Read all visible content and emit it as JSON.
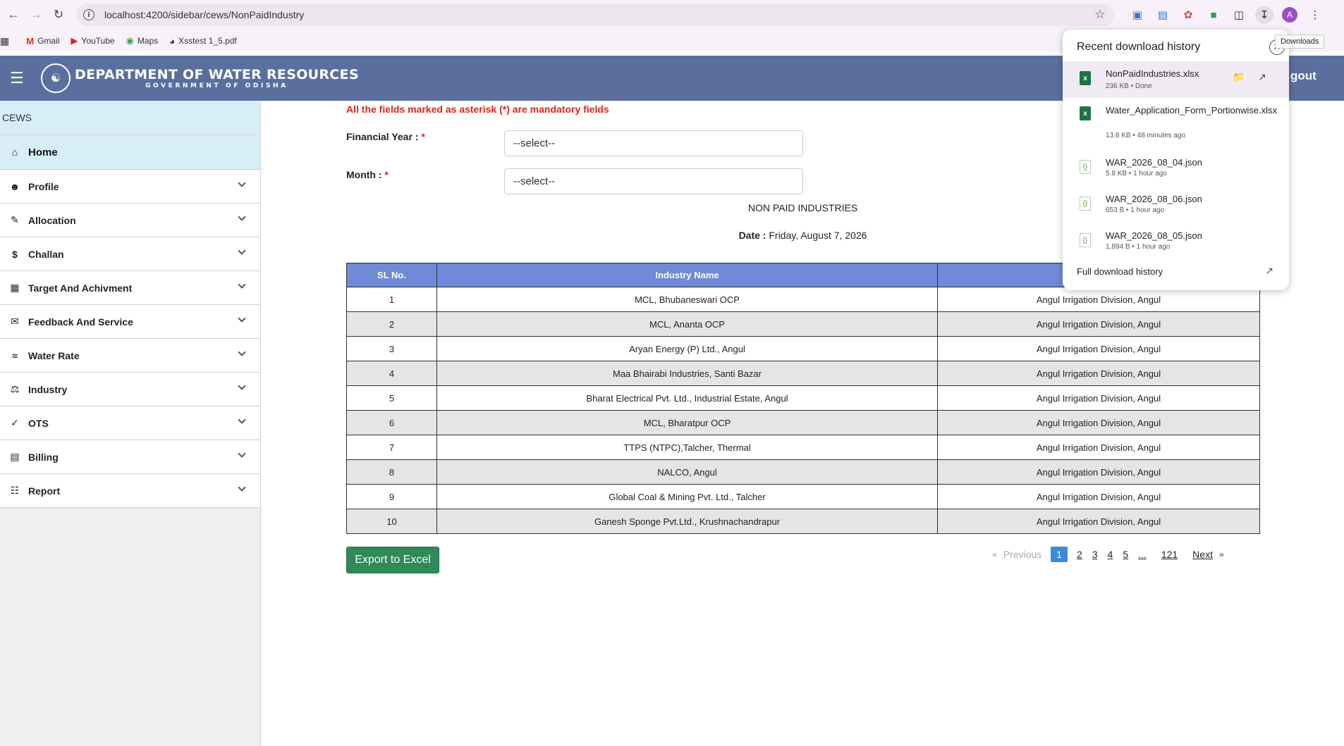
{
  "browser": {
    "url": "localhost:4200/sidebar/cews/NonPaidIndustry",
    "bookmarks": [
      {
        "label": "Gmail"
      },
      {
        "label": "YouTube"
      },
      {
        "label": "Maps"
      },
      {
        "label": "Xsstest 1_5.pdf"
      }
    ],
    "profile_initial": "A",
    "downloads_tooltip": "Downloads"
  },
  "header": {
    "title": "DEPARTMENT OF WATER RESOURCES",
    "subtitle": "GOVERNMENT OF ODISHA",
    "logout_label": "gout"
  },
  "sidebar": {
    "brand": "CEWS",
    "home_label": "Home",
    "items": [
      {
        "label": "Profile",
        "icon": "person-circle-icon"
      },
      {
        "label": "Allocation",
        "icon": "file-edit-icon"
      },
      {
        "label": "Challan",
        "icon": "dollar-circle-icon"
      },
      {
        "label": "Target And Achivment",
        "icon": "calendar-icon"
      },
      {
        "label": "Feedback And Service",
        "icon": "feedback-icon"
      },
      {
        "label": "Water Rate",
        "icon": "water-waves-icon"
      },
      {
        "label": "Industry",
        "icon": "factory-icon"
      },
      {
        "label": "OTS",
        "icon": "check-icon"
      },
      {
        "label": "Billing",
        "icon": "list-icon"
      },
      {
        "label": "Report",
        "icon": "books-icon"
      }
    ]
  },
  "form": {
    "mandatory_note": "All the fields marked as asterisk (*) are mandatory fields",
    "financial_year_label": "Financial Year :",
    "month_label": "Month :",
    "required_mark": "*",
    "financial_year_value": "--select--",
    "month_value": "--select--"
  },
  "report": {
    "title": "NON PAID INDUSTRIES",
    "date_label": "Date :",
    "date_value": "Friday, August 7, 2026"
  },
  "table": {
    "headers": [
      "SL No.",
      "Industry Name",
      ""
    ],
    "rows": [
      [
        "1",
        "MCL, Bhubaneswari OCP",
        "Angul Irrigation Division, Angul"
      ],
      [
        "2",
        "MCL, Ananta OCP",
        "Angul Irrigation Division, Angul"
      ],
      [
        "3",
        "Aryan Energy (P) Ltd., Angul",
        "Angul Irrigation Division, Angul"
      ],
      [
        "4",
        "Maa Bhairabi Industries, Santi Bazar",
        "Angul Irrigation Division, Angul"
      ],
      [
        "5",
        "Bharat Electrical Pvt. Ltd., Industrial Estate, Angul",
        "Angul Irrigation Division, Angul"
      ],
      [
        "6",
        "MCL, Bharatpur OCP",
        "Angul Irrigation Division, Angul"
      ],
      [
        "7",
        "TTPS (NTPC),Talcher, Thermal",
        "Angul Irrigation Division, Angul"
      ],
      [
        "8",
        "NALCO, Angul",
        "Angul Irrigation Division, Angul"
      ],
      [
        "9",
        "Global Coal & Mining Pvt. Ltd., Talcher",
        "Angul Irrigation Division, Angul"
      ],
      [
        "10",
        "Ganesh Sponge Pvt.Ltd., Krushnachandrapur",
        "Angul Irrigation Division, Angul"
      ]
    ]
  },
  "export_label": "Export to Excel",
  "pagination": {
    "prev_symbol": "«",
    "prev_label": "Previous",
    "pages": [
      "1",
      "2",
      "3",
      "4",
      "5",
      "...",
      "121"
    ],
    "active_page": "1",
    "next_label": "Next",
    "next_symbol": "»"
  },
  "downloads": {
    "title": "Recent download history",
    "items": [
      {
        "name": "NonPaidIndustries.xlsx",
        "meta": "236 KB • Done",
        "type": "xlsx"
      },
      {
        "name": "Water_Application_Form_Portionwise.xlsx",
        "meta": "13.8 KB • 48 minutes ago",
        "type": "xlsx"
      },
      {
        "name": "WAR_2026_08_04.json",
        "meta": "5.8 KB • 1 hour ago",
        "type": "json"
      },
      {
        "name": "WAR_2026_08_06.json",
        "meta": "653 B • 1 hour ago",
        "type": "json"
      },
      {
        "name": "WAR_2026_08_05.json",
        "meta": "1,894 B • 1 hour ago",
        "type": "json"
      }
    ],
    "full_history_label": "Full download history"
  },
  "colors": {
    "header_bg": "#5a6f9e",
    "table_header_bg": "#6f8ad6",
    "export_btn": "#2f8a58",
    "mandatory_red": "#e0221d",
    "active_page": "#3b8ad9"
  }
}
